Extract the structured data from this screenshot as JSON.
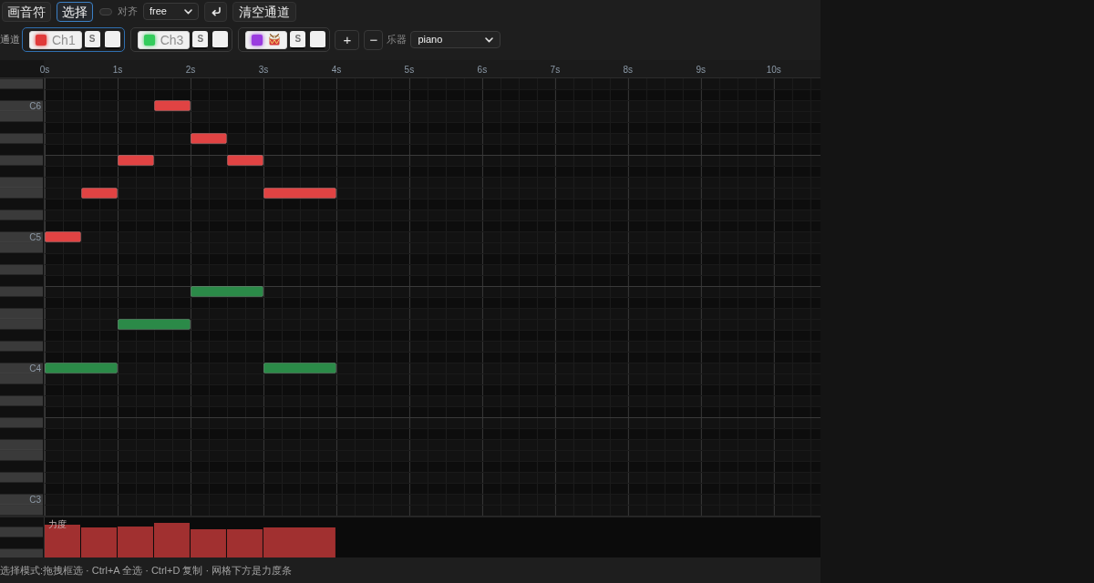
{
  "toolbar": {
    "modes": [
      {
        "label": "画音符",
        "selected": false
      },
      {
        "label": "选择",
        "selected": true
      }
    ],
    "snap": {
      "label": "对齐",
      "on": false,
      "value": "free"
    },
    "clear_label": "清空通道"
  },
  "channel_bar": {
    "label": "通道",
    "channels": [
      {
        "kind": "named",
        "name": "Ch1",
        "color": "#e03a3a",
        "selected": true,
        "solo_label": "S"
      },
      {
        "kind": "named",
        "name": "Ch3",
        "color": "#33cc5c",
        "selected": false,
        "solo_label": "S"
      },
      {
        "kind": "drum",
        "color": "#9a3be0",
        "selected": false,
        "solo_label": "S"
      }
    ],
    "add_label": "+",
    "remove_label": "−",
    "instrument": {
      "label": "乐器",
      "value": "piano"
    }
  },
  "piano_roll": {
    "chart_data": {
      "type": "bar",
      "orientation": "horizontal",
      "grid": true,
      "categories": [
        null,
        null,
        "C6",
        null,
        null,
        null,
        null,
        null,
        null,
        null,
        null,
        null,
        null,
        null,
        "C5",
        null,
        null,
        null,
        null,
        null,
        null,
        null,
        null,
        null,
        null,
        null,
        "C4",
        null,
        null,
        null,
        null,
        null,
        null,
        null,
        null,
        null,
        null,
        null,
        "C3",
        null
      ],
      "xticks": [
        {
          "value": 0,
          "label": "0s"
        },
        {
          "value": 1,
          "label": "1s"
        },
        {
          "value": 2,
          "label": "2s"
        },
        {
          "value": 3,
          "label": "3s"
        },
        {
          "value": 4,
          "label": "4s"
        },
        {
          "value": 5,
          "label": "5s"
        },
        {
          "value": 6,
          "label": "6s"
        },
        {
          "value": 7,
          "label": "7s"
        },
        {
          "value": 8,
          "label": "8s"
        },
        {
          "value": 9,
          "label": "9s"
        },
        {
          "value": 10,
          "label": "10s"
        }
      ],
      "xlim": [
        0,
        10.64
      ],
      "series": [
        {
          "color": "#e04343",
          "values": [
            null,
            null,
            0.5,
            null,
            null,
            0.5,
            null,
            0.5,
            null,
            null,
            0.5,
            null,
            null,
            null,
            0.5,
            null,
            null,
            null,
            null,
            null,
            null,
            null,
            null,
            null,
            null,
            null,
            null,
            null,
            null,
            null,
            null,
            null,
            null,
            null,
            null,
            null,
            null,
            null,
            null,
            null
          ],
          "base": [
            null,
            null,
            1.5,
            null,
            null,
            2,
            null,
            1,
            null,
            null,
            0.5,
            null,
            null,
            null,
            0,
            null,
            null,
            null,
            null,
            null,
            null,
            null,
            null,
            null,
            null,
            null,
            null,
            null,
            null,
            null,
            null,
            null,
            null,
            null,
            null,
            null,
            null,
            null,
            null,
            null
          ]
        },
        {
          "color": "#e04343",
          "values": [
            null,
            null,
            null,
            null,
            null,
            null,
            null,
            0.5,
            null,
            null,
            1,
            null,
            null,
            null,
            null,
            null,
            null,
            null,
            null,
            null,
            null,
            null,
            null,
            null,
            null,
            null,
            null,
            null,
            null,
            null,
            null,
            null,
            null,
            null,
            null,
            null,
            null,
            null,
            null,
            null
          ],
          "base": [
            null,
            null,
            null,
            null,
            null,
            null,
            null,
            2.5,
            null,
            null,
            3,
            null,
            null,
            null,
            null,
            null,
            null,
            null,
            null,
            null,
            null,
            null,
            null,
            null,
            null,
            null,
            null,
            null,
            null,
            null,
            null,
            null,
            null,
            null,
            null,
            null,
            null,
            null,
            null,
            null
          ]
        },
        {
          "color": "#2b8a48",
          "values": [
            null,
            null,
            null,
            null,
            null,
            null,
            null,
            null,
            null,
            null,
            null,
            null,
            null,
            null,
            null,
            null,
            null,
            null,
            null,
            1,
            null,
            null,
            1,
            null,
            null,
            null,
            1,
            null,
            null,
            null,
            null,
            null,
            null,
            null,
            null,
            null,
            null,
            null,
            null,
            null
          ],
          "base": [
            null,
            null,
            null,
            null,
            null,
            null,
            null,
            null,
            null,
            null,
            null,
            null,
            null,
            null,
            null,
            null,
            null,
            null,
            null,
            2,
            null,
            null,
            1,
            null,
            null,
            null,
            0,
            null,
            null,
            null,
            null,
            null,
            null,
            null,
            null,
            null,
            null,
            null,
            null,
            null
          ]
        },
        {
          "color": "#2b8a48",
          "values": [
            null,
            null,
            null,
            null,
            null,
            null,
            null,
            null,
            null,
            null,
            null,
            null,
            null,
            null,
            null,
            null,
            null,
            null,
            null,
            null,
            null,
            null,
            null,
            null,
            null,
            null,
            1,
            null,
            null,
            null,
            null,
            null,
            null,
            null,
            null,
            null,
            null,
            null,
            null,
            null
          ],
          "base": [
            null,
            null,
            null,
            null,
            null,
            null,
            null,
            null,
            null,
            null,
            null,
            null,
            null,
            null,
            null,
            null,
            null,
            null,
            null,
            null,
            null,
            null,
            null,
            null,
            null,
            null,
            3,
            null,
            null,
            null,
            null,
            null,
            null,
            null,
            null,
            null,
            null,
            null,
            null,
            null
          ]
        }
      ]
    }
  },
  "velocity_lane": {
    "label": "力度"
  },
  "status_bar": "选择模式:拖拽框选 · Ctrl+A 全选 · Ctrl+D 复制 · 网格下方是力度条"
}
